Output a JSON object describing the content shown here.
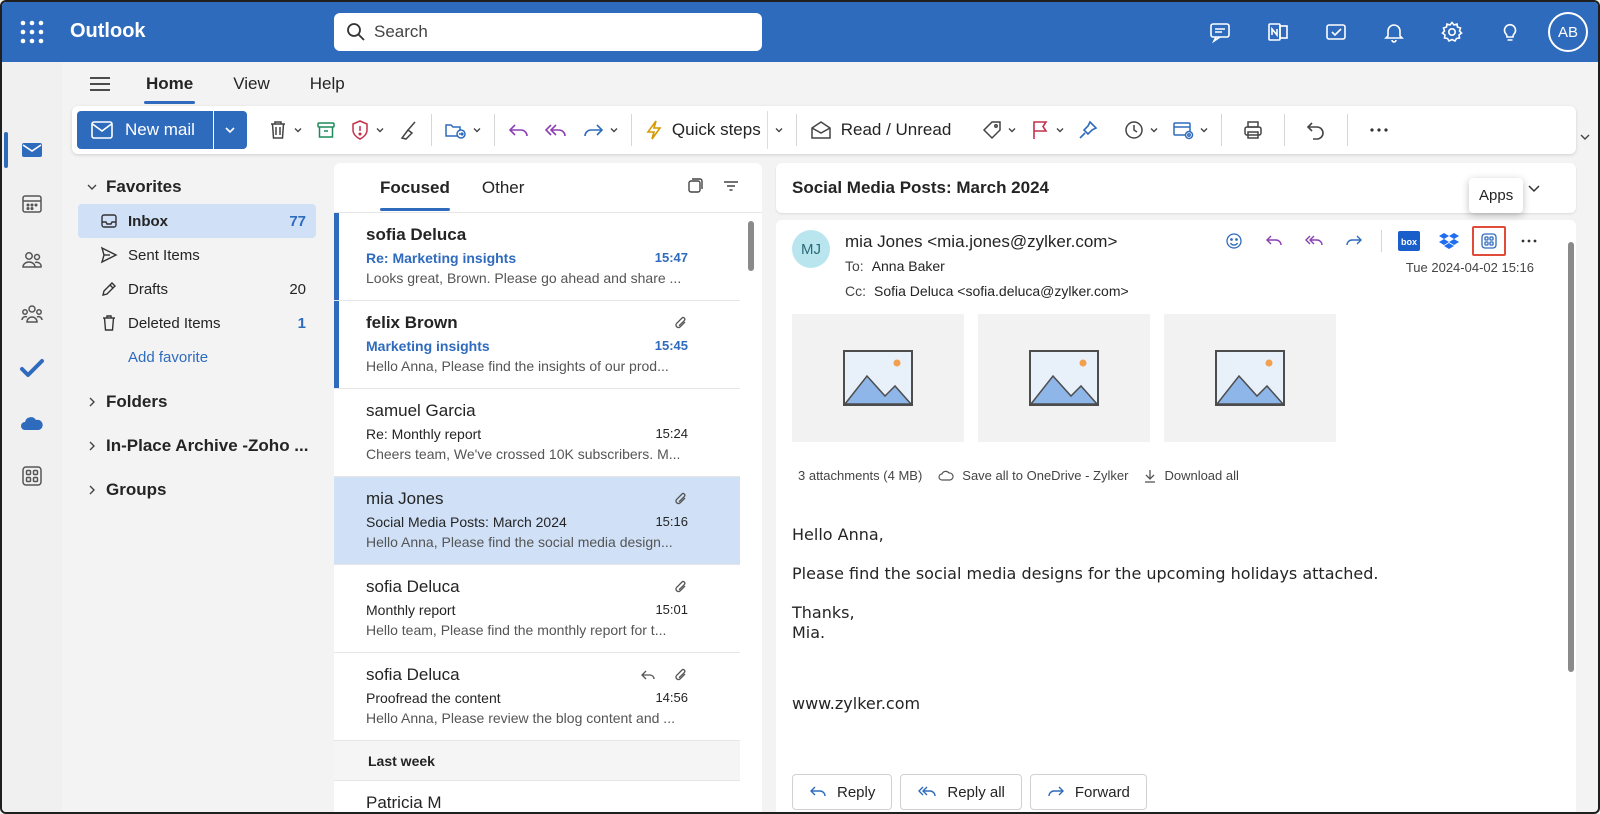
{
  "app": {
    "name": "Outlook"
  },
  "search": {
    "placeholder": "Search"
  },
  "user": {
    "initials": "AB"
  },
  "ribbon": {
    "tabs": [
      "Home",
      "View",
      "Help"
    ]
  },
  "toolbar": {
    "new_mail": "New mail",
    "quick_steps": "Quick steps",
    "read_unread": "Read / Unread"
  },
  "folders": {
    "favorites_label": "Favorites",
    "items": [
      {
        "label": "Inbox",
        "count": "77"
      },
      {
        "label": "Sent Items",
        "count": ""
      },
      {
        "label": "Drafts",
        "count": "20"
      },
      {
        "label": "Deleted Items",
        "count": "1"
      }
    ],
    "add_favorite": "Add favorite",
    "groups": [
      "Folders",
      "In-Place Archive -Zoho ...",
      "Groups"
    ]
  },
  "message_list": {
    "tabs": [
      "Focused",
      "Other"
    ],
    "messages": [
      {
        "from": "sofia Deluca",
        "subject": "Re: Marketing insights",
        "time": "15:47",
        "preview": "Looks great, Brown. Please go ahead and share ..."
      },
      {
        "from": "felix Brown",
        "subject": "Marketing insights",
        "time": "15:45",
        "preview": "Hello Anna, Please find the insights of our prod..."
      },
      {
        "from": "samuel Garcia",
        "subject": "Re: Monthly report",
        "time": "15:24",
        "preview": "Cheers team, We've crossed 10K subscribers. M..."
      },
      {
        "from": "mia Jones",
        "subject": "Social Media Posts: March 2024",
        "time": "15:16",
        "preview": "Hello Anna, Please find the social media design..."
      },
      {
        "from": "sofia Deluca",
        "subject": "Monthly report",
        "time": "15:01",
        "preview": "Hello team, Please find the monthly report for t..."
      },
      {
        "from": "sofia Deluca",
        "subject": "Proofread the content",
        "time": "14:56",
        "preview": "Hello Anna, Please review the blog content and ..."
      }
    ],
    "section_last_week": "Last week",
    "partial_from": "Patricia M"
  },
  "reading": {
    "subject": "Social Media Posts: March 2024",
    "avatar_initials": "MJ",
    "sender": "mia Jones <mia.jones@zylker.com>",
    "to_label": "To:",
    "to": "Anna Baker",
    "cc_label": "Cc:",
    "cc": "Sofia Deluca <sofia.deluca@zylker.com>",
    "date": "Tue 2024-04-02 15:16",
    "tooltip": "Apps",
    "attachments_summary": "3 attachments (4 MB)",
    "save_onedrive": "Save all to OneDrive - Zylker",
    "download_all": "Download all",
    "body": {
      "greeting": "Hello Anna,",
      "line1": "Please find the social media designs for the upcoming holidays attached.",
      "closing1": "Thanks,",
      "closing2": "Mia.",
      "website": "www.zylker.com"
    },
    "buttons": {
      "reply": "Reply",
      "reply_all": "Reply all",
      "forward": "Forward"
    }
  },
  "colors": {
    "brand": "#2f6bbd",
    "selected": "#cfe0f7",
    "highlight": "#e04b3a"
  }
}
